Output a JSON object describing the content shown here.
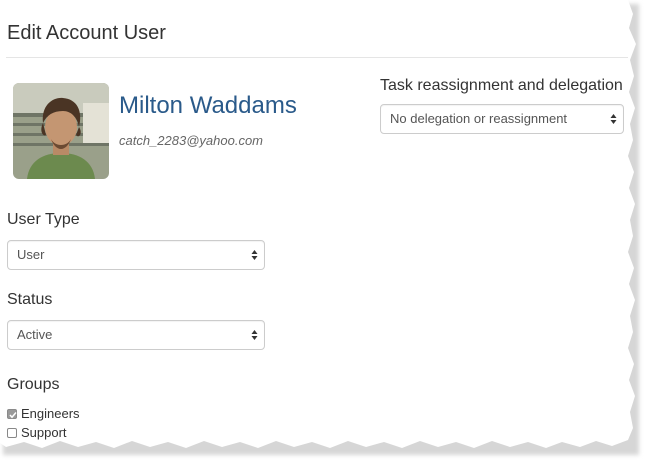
{
  "page": {
    "title": "Edit Account User"
  },
  "user": {
    "name": "Milton Waddams",
    "email": "catch_2283@yahoo.com"
  },
  "delegation": {
    "label": "Task reassignment and delegation",
    "selected": "No delegation or reassignment"
  },
  "user_type": {
    "label": "User Type",
    "selected": "User"
  },
  "status": {
    "label": "Status",
    "selected": "Active"
  },
  "groups": {
    "label": "Groups",
    "items": [
      {
        "label": "Engineers",
        "checked": true
      },
      {
        "label": "Support",
        "checked": false
      }
    ]
  },
  "colors": {
    "name": "#2a5a8a",
    "border": "#cccccc"
  }
}
